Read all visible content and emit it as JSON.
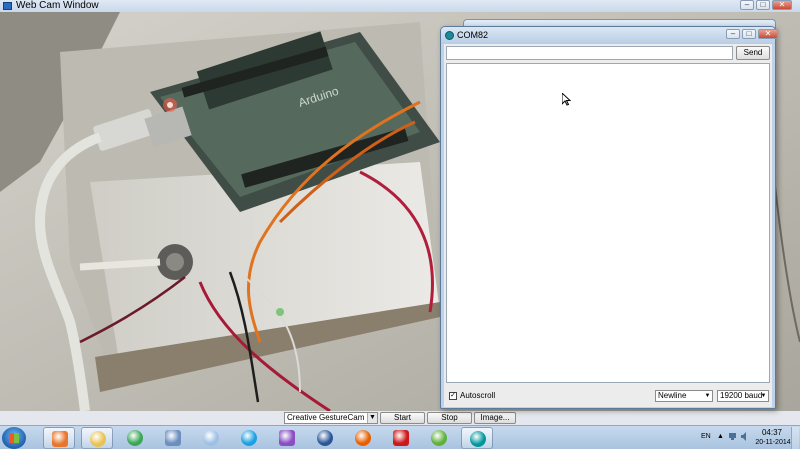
{
  "webcam_window": {
    "title": "Web Cam Window",
    "controls": {
      "camera_selected": "Creative GestureCam",
      "start_label": "Start",
      "stop_label": "Stop",
      "image_label": "Image..."
    }
  },
  "serial_monitor": {
    "title": "COM82",
    "send_input_value": "",
    "send_label": "Send",
    "autoscroll_checked": true,
    "autoscroll_label": "Autoscroll",
    "line_ending": "Newline",
    "baud_rate": "19200 baud"
  },
  "taskbar": {
    "items": [
      {
        "name": "media-player-icon",
        "color": "#e8762c"
      },
      {
        "name": "file-explorer-icon",
        "color": "#e8c350"
      },
      {
        "name": "chrome-icon",
        "color": "#3aa757"
      },
      {
        "name": "unknown-app-icon",
        "color": "#6d8fbf"
      },
      {
        "name": "paint-icon",
        "color": "#9ec0e6"
      },
      {
        "name": "skype-icon",
        "color": "#1aa1e1"
      },
      {
        "name": "podcast-app-icon",
        "color": "#8a4fc4"
      },
      {
        "name": "word-icon",
        "color": "#2b5797"
      },
      {
        "name": "firefox-icon",
        "color": "#e66000"
      },
      {
        "name": "opera-icon",
        "color": "#cc1a1a"
      },
      {
        "name": "people-app-icon",
        "color": "#5fb13a"
      },
      {
        "name": "arduino-icon",
        "color": "#00979c"
      }
    ],
    "tray": {
      "language": "EN",
      "time": "04:37",
      "date": "20-11-2014"
    }
  }
}
